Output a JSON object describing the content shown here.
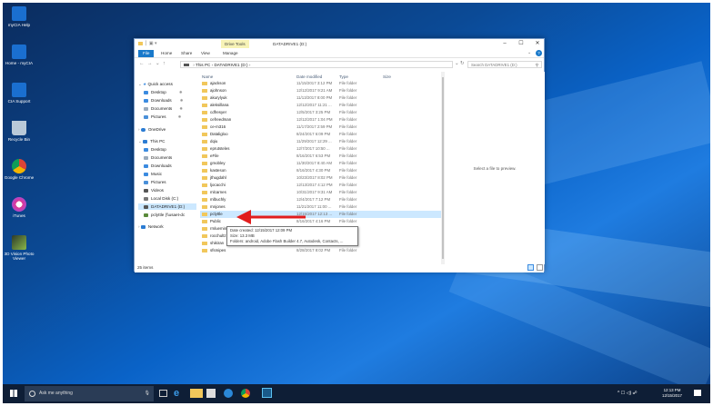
{
  "desktop": {
    "icons": [
      {
        "label": "myCIA Help",
        "icon": "edge-icon"
      },
      {
        "label": "Home - myCIA",
        "icon": "edge-icon"
      },
      {
        "label": "CIA Support",
        "icon": "edge-icon"
      },
      {
        "label": "Recycle Bin",
        "icon": "recycle-bin-icon"
      },
      {
        "label": "Google Chrome",
        "icon": "chrome-icon"
      },
      {
        "label": "iTunes",
        "icon": "itunes-icon"
      },
      {
        "label": "3D Vision Photo Viewer",
        "icon": "3d-vision-icon"
      }
    ]
  },
  "window": {
    "title": "DATADRIVE1 (D:)",
    "drive_tools": "Drive Tools",
    "tabs": [
      "File",
      "Home",
      "Share",
      "View",
      "Manage"
    ],
    "breadcrumb": [
      "This PC",
      "DATADRIVE1 (D:)"
    ],
    "search_placeholder": "Search DATADRIVE1 (D:)",
    "columns": {
      "name": "Name",
      "date": "Date modified",
      "type": "Type",
      "size": "Size"
    },
    "status": "25 items",
    "preview_text": "Select a file to preview."
  },
  "nav": {
    "quick_access": "Quick access",
    "quick_items": [
      "Desktop",
      "Downloads",
      "Documents",
      "Pictures"
    ],
    "onedrive": "OneDrive",
    "this_pc": "This PC",
    "pc_items": [
      "Desktop",
      "Documents",
      "Downloads",
      "Music",
      "Pictures",
      "Videos",
      "Local Disk (C:)",
      "DATADRIVE1 (D:)",
      "pclyttle (\\\\usaet-dc"
    ],
    "network": "Network"
  },
  "files": [
    {
      "name": "ajackson",
      "date": "11/15/2017 3:12 PM",
      "type": "File folder"
    },
    {
      "name": "ajohnson",
      "date": "12/12/2017 9:21 AM",
      "type": "File folder"
    },
    {
      "name": "akurylyuk",
      "date": "11/13/2017 8:00 PM",
      "type": "File folder"
    },
    {
      "name": "aleksillana",
      "date": "12/12/2017 11:21 ...",
      "type": "File folder"
    },
    {
      "name": "cdfresyer",
      "date": "12/5/2017 3:25 PM",
      "type": "File folder"
    },
    {
      "name": "cefreedman",
      "date": "12/12/2017 1:04 PM",
      "type": "File folder"
    },
    {
      "name": "ce-m316",
      "date": "11/17/2017 2:59 PM",
      "type": "File folder"
    },
    {
      "name": "Dataligloo",
      "date": "8/24/2017 6:09 PM",
      "type": "File folder"
    },
    {
      "name": "dqiu",
      "date": "11/29/2017 12:29 ...",
      "type": "File folder"
    },
    {
      "name": "eprutsteles",
      "date": "12/7/2017 10:50 ...",
      "type": "File folder"
    },
    {
      "name": "eFile",
      "date": "8/16/2017 6:53 PM",
      "type": "File folder"
    },
    {
      "name": "gmobley",
      "date": "11/30/2017 8:40 AM",
      "type": "File folder"
    },
    {
      "name": "kasteson",
      "date": "8/16/2017 4:30 PM",
      "type": "File folder"
    },
    {
      "name": "jthugdahl",
      "date": "10/23/2017 8:02 PM",
      "type": "File folder"
    },
    {
      "name": "ljocacchi",
      "date": "12/13/2017 4:12 PM",
      "type": "File folder"
    },
    {
      "name": "mlcarnes",
      "date": "10/31/2017 9:31 AM",
      "type": "File folder"
    },
    {
      "name": "mlbuchly",
      "date": "12/4/2017 7:12 PM",
      "type": "File folder"
    },
    {
      "name": "mnjones",
      "date": "11/21/2017 11:00 ...",
      "type": "File folder"
    },
    {
      "name": "pclyttle",
      "date": "12/15/2017 12:13 ...",
      "type": "File folder"
    },
    {
      "name": "Public",
      "date": "8/16/2017 4:16 PM",
      "type": "File folder"
    },
    {
      "name": "rmluemin",
      "date": "",
      "type": ""
    },
    {
      "name": "rocchultz",
      "date": "",
      "type": ""
    },
    {
      "name": "shikiran",
      "date": "10/2/2017 8:02 PM",
      "type": "File folder"
    },
    {
      "name": "sfsmipes",
      "date": "8/28/2017 8:02 PM",
      "type": "File folder"
    }
  ],
  "tooltip": {
    "line1": "Date created: 12/15/2017 12:09 PM",
    "line2": "Size: 13.3 MB",
    "line3": "Folders: android, Adobe Flash Builder 4.7, Autodesk, Contacts, ..."
  },
  "taskbar": {
    "search_placeholder": "Ask me anything",
    "time": "12:13 PM",
    "date": "12/15/2017"
  },
  "colors": {
    "accent": "#1979ca",
    "selection": "#cce8ff",
    "arrow": "#e11d1d",
    "folder": "#f1c75b"
  }
}
